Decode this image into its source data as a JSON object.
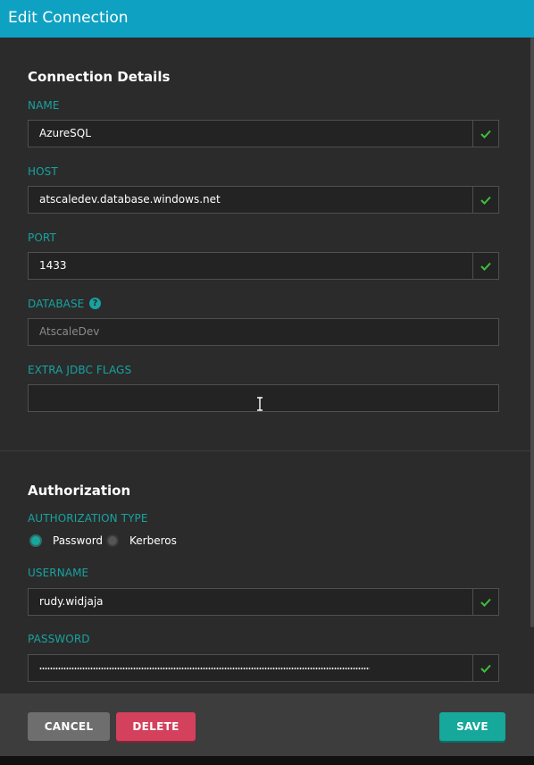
{
  "dialog": {
    "title": "Edit Connection"
  },
  "connection_details": {
    "title": "Connection Details",
    "name": {
      "label": "NAME",
      "value": "AzureSQL"
    },
    "host": {
      "label": "HOST",
      "value": "atscaledev.database.windows.net"
    },
    "port": {
      "label": "PORT",
      "value": "1433"
    },
    "database": {
      "label": "DATABASE",
      "placeholder": "AtscaleDev",
      "help_icon": "question-circle-icon"
    },
    "extra_jdbc_flags": {
      "label": "EXTRA JDBC FLAGS",
      "value": ""
    }
  },
  "authorization": {
    "title": "Authorization",
    "type_label": "AUTHORIZATION TYPE",
    "options": [
      {
        "label": "Password",
        "selected": true
      },
      {
        "label": "Kerberos",
        "selected": false
      }
    ],
    "username": {
      "label": "USERNAME",
      "value": "rudy.widjaja"
    },
    "password": {
      "label": "PASSWORD"
    }
  },
  "footer": {
    "cancel_label": "CANCEL",
    "delete_label": "DELETE",
    "save_label": "SAVE"
  },
  "colors": {
    "header": "#0ea1c2",
    "accent": "#17a3a0",
    "check": "#3fbf3f",
    "delete": "#d4415d",
    "save": "#16a89b"
  }
}
